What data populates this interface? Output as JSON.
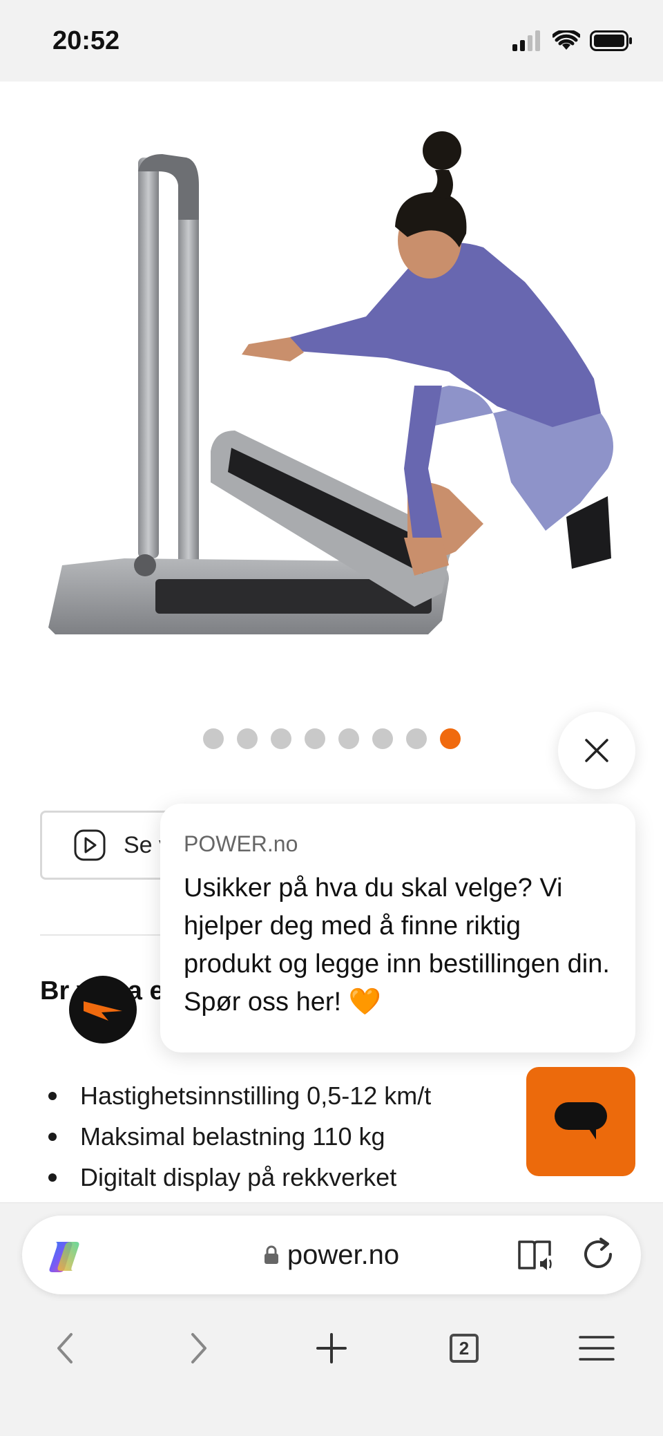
{
  "status_bar": {
    "time": "20:52"
  },
  "carousel": {
    "total_dots": 8,
    "active_index": 7,
    "inactive_color": "#c9c9c9",
    "active_color": "#f06a0e"
  },
  "video_button": {
    "label": "Se v"
  },
  "section": {
    "title": "Br ve sa en",
    "features": [
      "Hastighetsinnstilling 0,5-12 km/t",
      "Maksimal belastning 110 kg",
      "Digitalt display på rekkverket"
    ]
  },
  "chat": {
    "source": "POWER.no",
    "message": "Usikker på hva du skal velge? Vi hjelper deg med å finne riktig produkt og legge inn bestillingen din. Spør oss her! 🧡",
    "accent_color": "#ec6a0c"
  },
  "browser": {
    "url": "power.no",
    "tab_count": "2"
  },
  "icons": {
    "copilot": "copilot-icon",
    "lock": "lock-icon",
    "reader": "reader-mode-icon",
    "reload": "reload-icon",
    "back": "chevron-left-icon",
    "forward": "chevron-right-icon",
    "new_tab": "plus-icon",
    "menu": "hamburger-menu-icon",
    "close": "close-icon",
    "chat": "chat-bubble-icon",
    "play": "play-icon"
  }
}
